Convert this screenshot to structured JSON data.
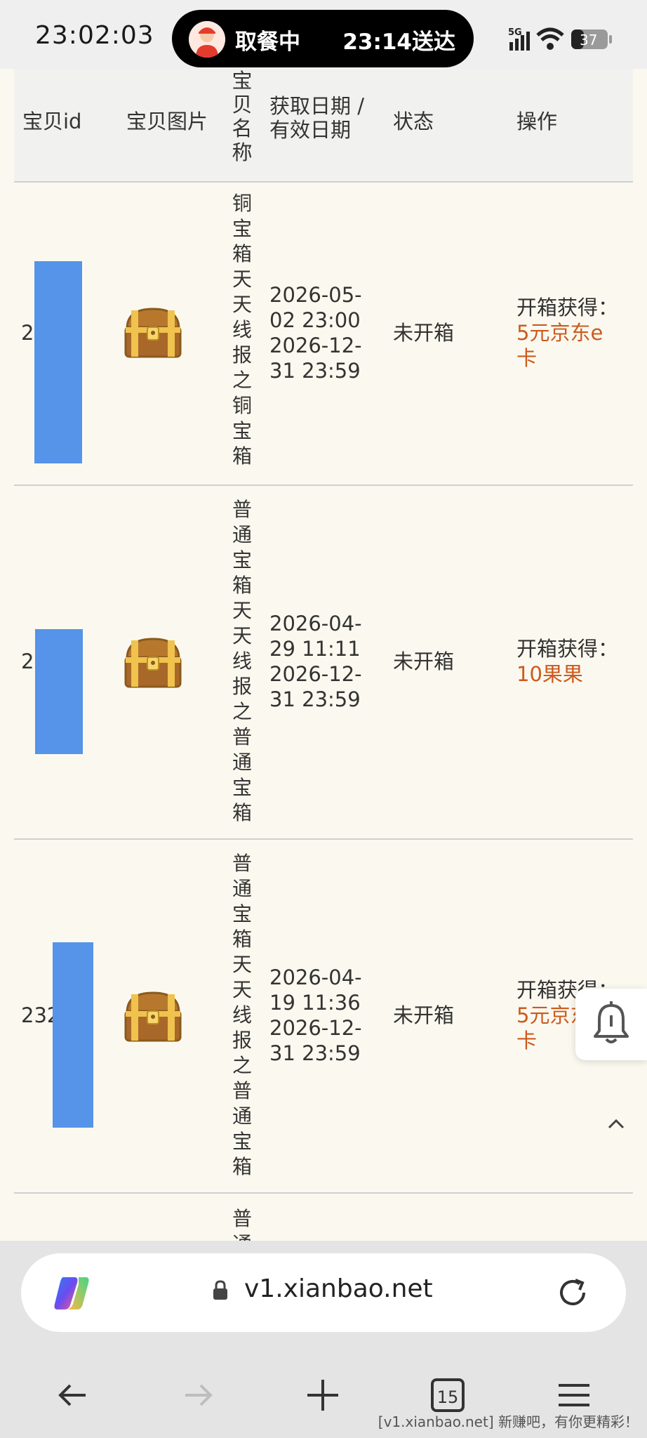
{
  "status_bar": {
    "time": "23:02:03",
    "delivery_status": "取餐中",
    "delivery_eta": "23:14送达",
    "network": "5G",
    "battery": "37"
  },
  "table": {
    "headers": {
      "id": "宝贝id",
      "image": "宝贝图片",
      "name": "宝贝名称",
      "dates": "获取日期 / 有效日期",
      "status": "状态",
      "action": "操作"
    },
    "rows": [
      {
        "id_visible": "2",
        "name": "铜宝箱天天线报之铜宝箱",
        "get_date": "2026-05-02 23:00",
        "expire_date": "2026-12-31 23:59",
        "status": "未开箱",
        "action_label": "开箱获得：",
        "reward": "5元京东e卡"
      },
      {
        "id_visible": "2",
        "name": "普通宝箱天天线报之普通宝箱",
        "get_date": "2026-04-29 11:11",
        "expire_date": "2026-12-31 23:59",
        "status": "未开箱",
        "action_label": "开箱获得：",
        "reward": "10果果"
      },
      {
        "id_visible": "232",
        "name": "普通宝箱天天线报之普通宝箱",
        "get_date": "2026-04-19 11:36",
        "expire_date": "2026-12-31 23:59",
        "status": "未开箱",
        "action_label": "开箱获得：",
        "reward": "5元京东e卡"
      },
      {
        "name": "普通"
      }
    ]
  },
  "browser": {
    "url": "v1.xianbao.net",
    "tab_count": "15"
  },
  "watermark": "[v1.xianbao.net] 新赚吧，有你更精彩！",
  "colors": {
    "reward": "#cc5a1e",
    "id_redaction": "#5594e8",
    "page_bg": "#fbf9ef"
  }
}
